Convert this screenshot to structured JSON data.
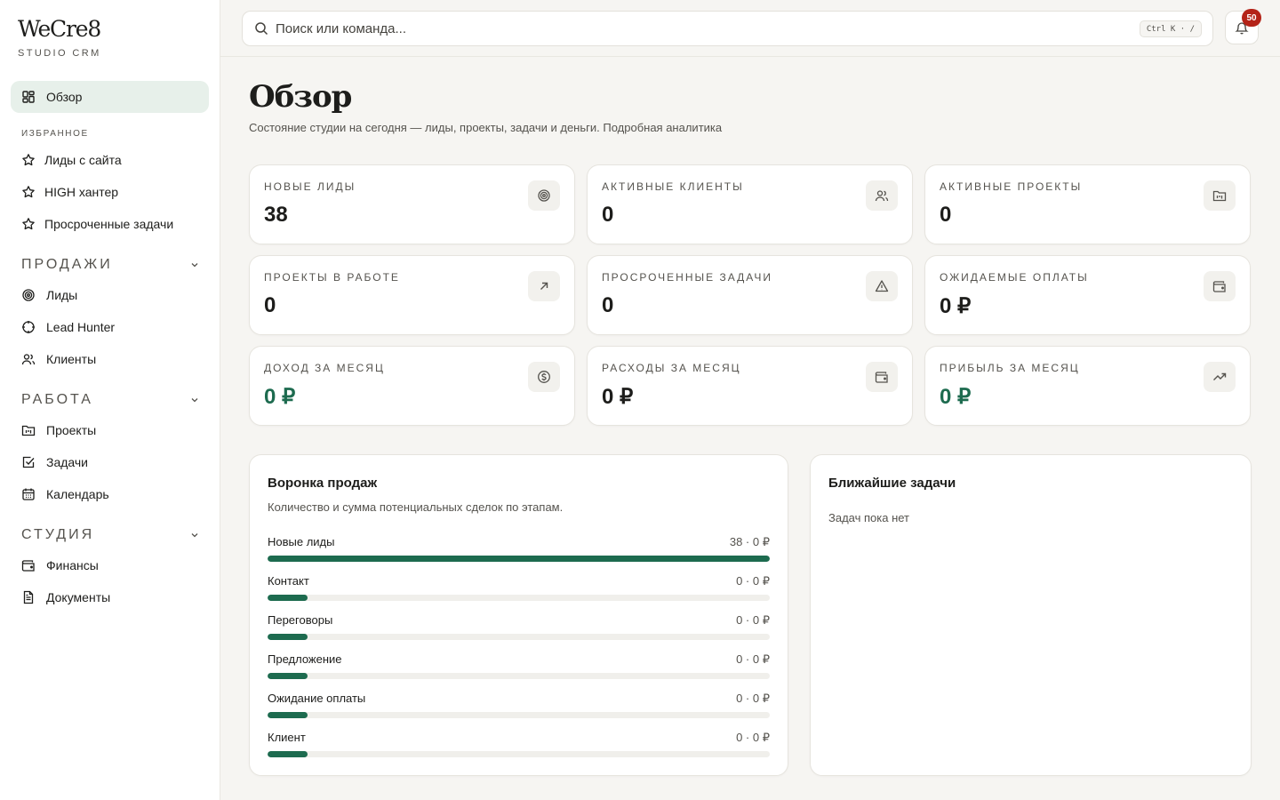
{
  "brand": {
    "name": "WeCre8",
    "subtitle": "STUDIO CRM"
  },
  "sidebar": {
    "active": {
      "label": "Обзор",
      "icon": "dashboard-icon"
    },
    "favorites_heading": "ИЗБРАННОЕ",
    "favorites": [
      {
        "label": "Лиды с сайта",
        "icon": "star-icon"
      },
      {
        "label": "HIGH хантер",
        "icon": "star-icon"
      },
      {
        "label": "Просроченные задачи",
        "icon": "star-icon"
      }
    ],
    "groups": [
      {
        "title": "ПРОДАЖИ",
        "items": [
          {
            "label": "Лиды",
            "icon": "target-icon"
          },
          {
            "label": "Lead Hunter",
            "icon": "crosshair-icon"
          },
          {
            "label": "Клиенты",
            "icon": "users-icon"
          }
        ]
      },
      {
        "title": "РАБОТА",
        "items": [
          {
            "label": "Проекты",
            "icon": "folder-kanban-icon"
          },
          {
            "label": "Задачи",
            "icon": "checkbox-icon"
          },
          {
            "label": "Календарь",
            "icon": "calendar-icon"
          }
        ]
      },
      {
        "title": "СТУДИЯ",
        "items": [
          {
            "label": "Финансы",
            "icon": "wallet-icon"
          },
          {
            "label": "Документы",
            "icon": "document-icon"
          }
        ]
      }
    ]
  },
  "topbar": {
    "search_placeholder": "Поиск или команда...",
    "shortcut": "Ctrl K · /",
    "notifications_count": "50"
  },
  "page": {
    "title": "Обзор",
    "subtitle": "Состояние студии на сегодня — лиды, проекты, задачи и деньги. Подробная аналитика"
  },
  "stats": [
    {
      "label": "НОВЫЕ ЛИДЫ",
      "value": "38",
      "icon": "target-icon"
    },
    {
      "label": "АКТИВНЫЕ КЛИЕНТЫ",
      "value": "0",
      "icon": "users-icon"
    },
    {
      "label": "АКТИВНЫЕ ПРОЕКТЫ",
      "value": "0",
      "icon": "folder-kanban-icon"
    },
    {
      "label": "ПРОЕКТЫ В РАБОТЕ",
      "value": "0",
      "icon": "arrow-up-right-icon"
    },
    {
      "label": "ПРОСРОЧЕННЫЕ ЗАДАЧИ",
      "value": "0",
      "icon": "alert-triangle-icon"
    },
    {
      "label": "ОЖИДАЕМЫЕ ОПЛАТЫ",
      "value": "0 ₽",
      "icon": "wallet-icon"
    },
    {
      "label": "ДОХОД ЗА МЕСЯЦ",
      "value": "0 ₽",
      "icon": "dollar-circle-icon"
    },
    {
      "label": "РАСХОДЫ ЗА МЕСЯЦ",
      "value": "0 ₽",
      "icon": "wallet-icon"
    },
    {
      "label": "ПРИБЫЛЬ ЗА МЕСЯЦ",
      "value": "0 ₽",
      "icon": "trending-up-icon"
    }
  ],
  "funnel": {
    "title": "Воронка продаж",
    "subtitle": "Количество и сумма потенциальных сделок по этапам.",
    "stages": [
      {
        "name": "Новые лиды",
        "value": "38 · 0 ₽",
        "share": 1.0
      },
      {
        "name": "Контакт",
        "value": "0 · 0 ₽",
        "share": 0.08
      },
      {
        "name": "Переговоры",
        "value": "0 · 0 ₽",
        "share": 0.08
      },
      {
        "name": "Предложение",
        "value": "0 · 0 ₽",
        "share": 0.08
      },
      {
        "name": "Ожидание оплаты",
        "value": "0 · 0 ₽",
        "share": 0.08
      },
      {
        "name": "Клиент",
        "value": "0 · 0 ₽",
        "share": 0.08
      }
    ]
  },
  "upcoming": {
    "title": "Ближайшие задачи",
    "empty": "Задач пока нет"
  },
  "colors": {
    "accent": "#1d6b4f",
    "accent_soft": "#e7f0ea",
    "badge": "#b42318"
  }
}
